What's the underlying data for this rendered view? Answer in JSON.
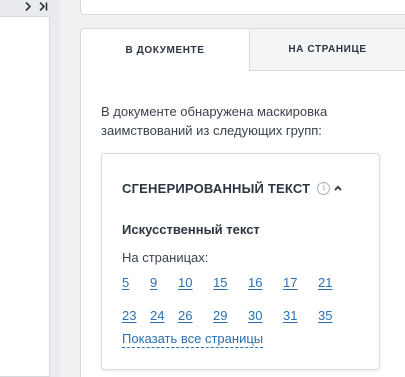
{
  "report": {
    "tabs": [
      {
        "label": "В ДОКУМЕНТЕ",
        "active": true
      },
      {
        "label": "НА СТРАНИЦЕ",
        "active": false
      }
    ],
    "intro_text": "В документе обнаружена маскировка заимствований из следующих групп:",
    "group": {
      "title": "СГЕНЕРИРОВАННЫЙ ТЕКСТ",
      "info_icon": "info-icon",
      "collapse_icon": "chevron-up-icon",
      "category": "Искусственный текст",
      "pages_label": "На страницах:",
      "pages": [
        "5",
        "9",
        "10",
        "15",
        "16",
        "17",
        "21",
        "23",
        "24",
        "26",
        "29",
        "30",
        "31",
        "35"
      ],
      "show_all_label": "Показать все страницы"
    }
  },
  "nav": {
    "next_icon": "chevron-right-icon",
    "last_icon": "chevron-last-icon"
  },
  "colors": {
    "link": "#2b6fb0",
    "text": "#2c3541",
    "border": "#d6d9de",
    "background": "#f0f1f3"
  }
}
